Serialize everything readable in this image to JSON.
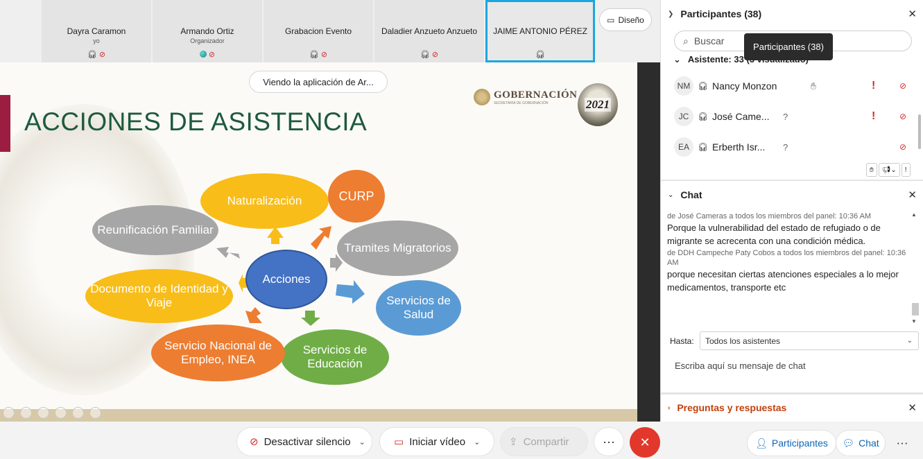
{
  "participants_strip": [
    {
      "name": "Dayra Caramon",
      "role": "yo"
    },
    {
      "name": "Armando Ortiz",
      "role": "Organizador"
    },
    {
      "name": "Grabacion Evento",
      "role": ""
    },
    {
      "name": "Daladier Anzueto Anzueto",
      "role": ""
    },
    {
      "name": "JAIME ANTONIO PÉREZ",
      "role": ""
    }
  ],
  "layout_button": "Diseño",
  "viewing_label": "Viendo la aplicación de Ar...",
  "slide": {
    "title": "ACCIONES DE ASISTENCIA",
    "logo_text": "GOBERNACIÓN",
    "logo_sub": "SECRETARÍA DE GOBERNACIÓN",
    "year_logo": "2021",
    "center": "Acciones",
    "nodes": {
      "naturalizacion": "Naturalización",
      "curp": "CURP",
      "tramites": "Tramites Migratorios",
      "salud": "Servicios de Salud",
      "educacion": "Servicios de Educación",
      "empleo": "Servicio Nacional de Empleo, INEA",
      "documento": "Documento de Identidad y Viaje",
      "reunificacion": "Reunificación Familiar"
    }
  },
  "bottombar": {
    "mute": "Desactivar silencio",
    "video": "Iniciar vídeo",
    "share": "Compartir",
    "participants": "Participantes",
    "chat": "Chat"
  },
  "panel": {
    "participants_title": "Participantes (38)",
    "search_placeholder": "Buscar",
    "tooltip": "Participantes (38)",
    "attendee_group": "Asistente: 33 (3 visualizado)",
    "rows": [
      {
        "initials": "NM",
        "name": "Nancy Monzon"
      },
      {
        "initials": "JC",
        "name": "José Came..."
      },
      {
        "initials": "EA",
        "name": "Erberth Isr..."
      }
    ],
    "chat_title": "Chat",
    "messages": [
      {
        "meta": "de José Cameras a todos los miembros del panel:     10:36 AM",
        "text": "Porque la vulnerabilidad del estado de refugiado o de migrante se acrecenta con una condición médica."
      },
      {
        "meta": "de DDH Campeche Paty Cobos a todos los miembros del panel: 10:36 AM",
        "text": "porque necesitan ciertas atenciones especiales a lo mejor medicamentos, transporte  etc"
      }
    ],
    "to_label": "Hasta:",
    "to_value": "Todos los asistentes",
    "chat_placeholder": "Escriba aquí su mensaje de chat",
    "qa_title": "Preguntas y respuestas"
  }
}
